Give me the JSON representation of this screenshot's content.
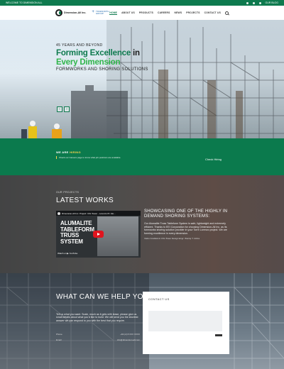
{
  "topbar": {
    "welcome": "WELCOME TO DIMENSION ALL",
    "blog": "OUR BLOG"
  },
  "header": {
    "logo_name": "Dimension-All Inc.",
    "logo_sub": "",
    "partner_name": "TRUENORTH",
    "partner_sub": "GROUP",
    "nav": [
      "HOME",
      "ABOUT US",
      "PRODUCTS",
      "CAREERS",
      "NEWS",
      "PROJECTS",
      "CONTACT US"
    ]
  },
  "hero": {
    "eyebrow": "45 YEARS AND BEYOND",
    "headline_part1": "Forming Excellence",
    "headline_part2": " in",
    "headline_part3": "Every Dimension",
    "tagline": "FORMWORKS AND SHORING SOLUTIONS",
    "prev": "‹",
    "next": "›"
  },
  "hiring": {
    "title_part1": "WE ARE ",
    "title_part2": "HIRING",
    "text": "Check our Careers page to know what job positions are available.",
    "button": "Check Hiring"
  },
  "works": {
    "eyebrow": "OUR PROJECTS",
    "title": "LATEST WORKS",
    "video_title": "Dimension-All Inc. Project: CIG Tower - Lorenzo Pt. Alo...",
    "video_caption": "ALUMALITE TABLEFORM TRUSS SYSTEM",
    "video_footer": "Watch on ▶ YouTube",
    "right_heading": "SHOWCASING ONE OF THE HIGHLY IN DEMAND SHORING SYSTEMS:",
    "right_body": "Our Alumalite Truss Tableform System is safe, lightweight and extremely efficient. Thanks to EEI Corporation for choosing Dimension-All Inc. as its formworks shoring solution provider in your Torre Lorenzo project. We are forming excellence in every dimension.",
    "right_caption": "Video Credited to CIG Tower Design Engr. Wendy T. Arlina"
  },
  "help": {
    "title": "WHAT CAN WE HELP YOU BUILD?",
    "text": "Tell us what you want. Scale, much as it gets with lease, please give us small details about what you'd like to build. We will send you the shortest answer we can respond to you with the best that you require.",
    "left_1": "Phone",
    "right_1": "+63 (2) 8 XXX XXXX",
    "left_2": "Email",
    "right_2": "info@dimension-all.com",
    "contact_title": "CONTACT US"
  }
}
